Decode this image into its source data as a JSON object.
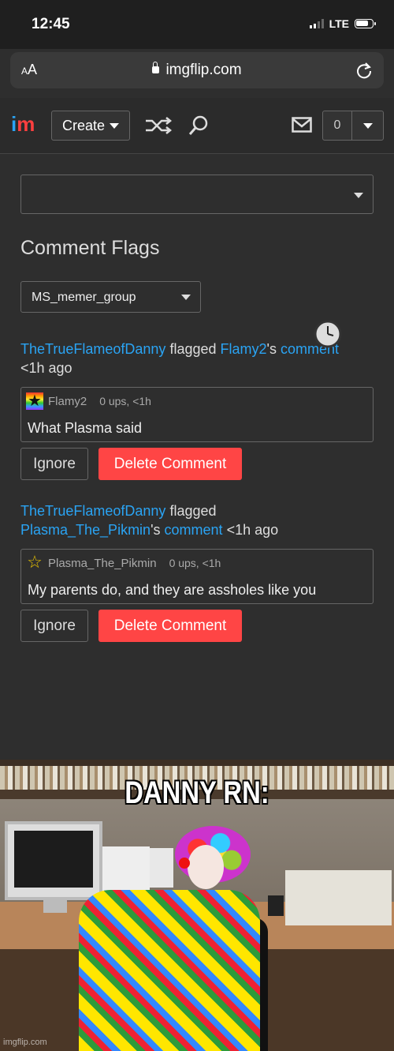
{
  "status_bar": {
    "time": "12:45",
    "network": "LTE"
  },
  "browser": {
    "aa_small": "A",
    "aa_large": "A",
    "url": "imgflip.com"
  },
  "nav": {
    "logo_i": "i",
    "logo_m": "m",
    "create_label": "Create",
    "notification_count": "0"
  },
  "page": {
    "heading": "Comment Flags",
    "group_select_value": "MS_memer_group"
  },
  "flags": [
    {
      "flagger": "TheTrueFlameofDanny",
      "flagged_text": "flagged",
      "user": "Flamy2",
      "possessive": "'s",
      "comment_link": "comment",
      "time": "<1h ago",
      "comment_user": "Flamy2",
      "comment_meta": "0 ups, <1h",
      "comment_text": "What Plasma said",
      "ignore_label": "Ignore",
      "delete_label": "Delete Comment"
    },
    {
      "flagger": "TheTrueFlameofDanny",
      "flagged_text": "flagged",
      "user": "Plasma_The_Pikmin",
      "possessive": "'s",
      "comment_link": "comment",
      "time": "<1h ago",
      "comment_user": "Plasma_The_Pikmin",
      "comment_meta": "0 ups, <1h",
      "comment_text": "My parents do, and they are assholes like you",
      "ignore_label": "Ignore",
      "delete_label": "Delete Comment"
    }
  ],
  "meme": {
    "caption": "DANNY RN:",
    "watermark": "imgflip.com"
  },
  "colors": {
    "link": "#2aa4f4",
    "delete": "#ff4545",
    "logo_m": "#ff3f3f"
  }
}
